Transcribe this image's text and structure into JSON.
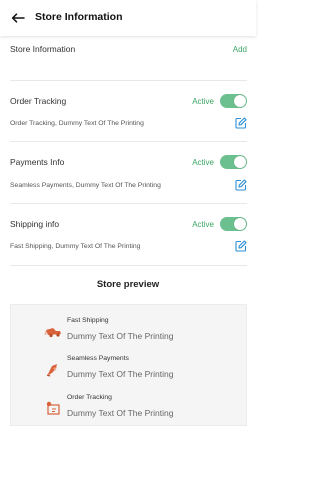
{
  "header": {
    "title": "Store Information"
  },
  "store_info": {
    "label": "Store Information",
    "add_label": "Add"
  },
  "sections": [
    {
      "title": "Order Tracking",
      "status": "Active",
      "description": "Order Tracking, Dummy Text Of The Printing"
    },
    {
      "title": "Payments Info",
      "status": "Active",
      "description": "Seamless Payments, Dummy Text Of The Printing"
    },
    {
      "title": "Shipping info",
      "status": "Active",
      "description": "Fast Shipping, Dummy Text Of The Printing"
    }
  ],
  "preview": {
    "title": "Store preview",
    "items": [
      {
        "name": "Fast Shipping",
        "text": "Dummy Text Of The Printing",
        "icon": "truck-icon"
      },
      {
        "name": "Seamless Payments",
        "text": "Dummy Text Of The Printing",
        "icon": "payment-hand-icon"
      },
      {
        "name": "Order Tracking",
        "text": "Dummy Text Of The Printing",
        "icon": "tracking-icon"
      }
    ]
  },
  "colors": {
    "accent": "#3aa566",
    "toggle": "#6cc08f",
    "icon": "#d9623b",
    "edit": "#2d8fd5"
  }
}
